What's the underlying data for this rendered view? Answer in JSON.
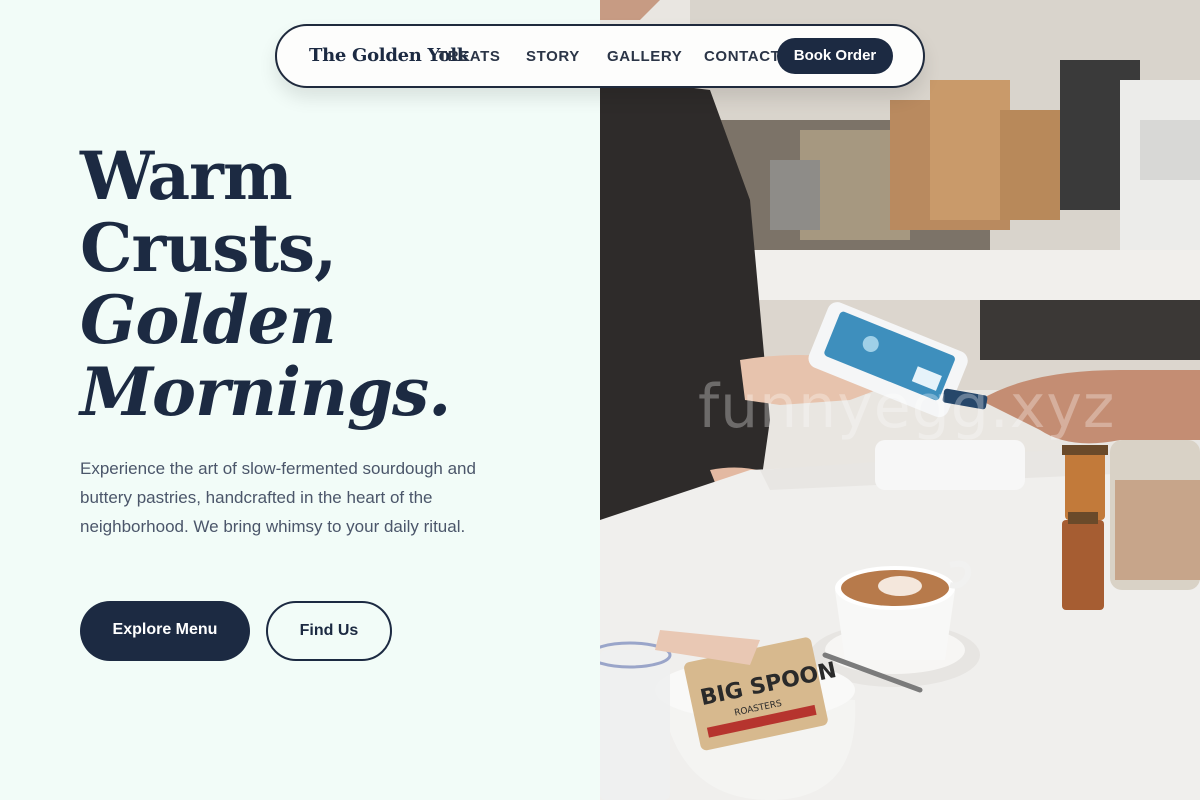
{
  "brand": {
    "name": "The Golden Yolk"
  },
  "nav": {
    "links": [
      "TREATS",
      "STORY",
      "GALLERY",
      "CONTACT"
    ],
    "cta": "Book Order"
  },
  "hero": {
    "title_line1": "Warm",
    "title_line2": "Crusts,",
    "title_line3": "Golden",
    "title_line4": "Mornings.",
    "description": "Experience the art of slow-fermented sourdough and buttery pastries, handcrafted in the heart of the neighborhood. We bring whimsy to your daily ritual.",
    "primary_button": "Explore Menu",
    "secondary_button": "Find Us"
  },
  "photo": {
    "watermark": "funnyegg.xyz",
    "bag_label_1": "BIG SPOON",
    "bag_label_2": "ROASTERS"
  },
  "colors": {
    "primary": "#1c2a42",
    "background": "#f2fcf8",
    "body_text": "#4b566a"
  }
}
